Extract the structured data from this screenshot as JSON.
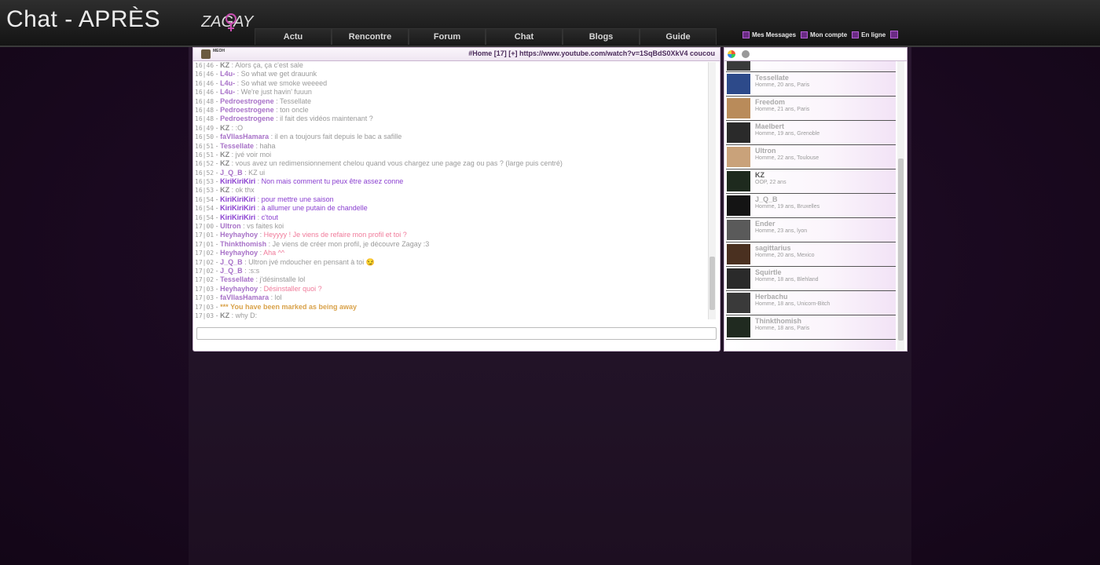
{
  "header": {
    "title": "Chat - APRÈS",
    "logo_text": "ZAGAY"
  },
  "nav": [
    {
      "label": "Actu"
    },
    {
      "label": "Rencontre"
    },
    {
      "label": "Forum"
    },
    {
      "label": "Chat"
    },
    {
      "label": "Blogs"
    },
    {
      "label": "Guide"
    }
  ],
  "user_links": {
    "messages": "Mes Messages",
    "account": "Mon compte",
    "online": "En ligne"
  },
  "chat": {
    "mini_tag": "MEOH",
    "topic": "#Home [17] [+] https://www.youtube.com/watch?v=1SqBdS0XkV4 coucou",
    "messages": [
      {
        "time": "16|46",
        "name": "KZ",
        "text": "Alors ça, ça c'est sale"
      },
      {
        "time": "16|46",
        "name": "L4u-",
        "text": "So what we get drauunk"
      },
      {
        "time": "16|46",
        "name": "L4u-",
        "text": "So what we smoke weeeed"
      },
      {
        "time": "16|46",
        "name": "L4u-",
        "text": "We're just havin' fuuun"
      },
      {
        "time": "16|48",
        "name": "Pedroestrogene",
        "text": "Tessellate"
      },
      {
        "time": "16|48",
        "name": "Pedroestrogene",
        "text": "ton oncle"
      },
      {
        "time": "16|48",
        "name": "Pedroestrogene",
        "text": "il fait des vidéos maintenant ?"
      },
      {
        "time": "16|49",
        "name": "KZ",
        "text": ":O"
      },
      {
        "time": "16|50",
        "name": "faVIlasHamara",
        "text": "il en a toujours fait depuis le bac a safille"
      },
      {
        "time": "16|51",
        "name": "Tessellate",
        "text": "haha"
      },
      {
        "time": "16|51",
        "name": "KZ",
        "text": "jvé voir moi"
      },
      {
        "time": "16|52",
        "name": "KZ",
        "text": "vous avez un redimensionnement chelou quand vous chargez une page zag ou pas ? (large puis centré)"
      },
      {
        "time": "16|52",
        "name": "J_Q_B",
        "text": "KZ ui"
      },
      {
        "time": "16|53",
        "name": "KiriKiriKiri",
        "text": "Non mais comment tu peux être assez conne"
      },
      {
        "time": "16|53",
        "name": "KZ",
        "text": "ok thx"
      },
      {
        "time": "16|54",
        "name": "KiriKiriKiri",
        "text": "pour mettre une saison"
      },
      {
        "time": "16|54",
        "name": "KiriKiriKiri",
        "text": "à allumer une putain de chandelle"
      },
      {
        "time": "16|54",
        "name": "KiriKiriKiri",
        "text": "c'tout"
      },
      {
        "time": "17|00",
        "name": "Ultron",
        "text": "vs faites koi"
      },
      {
        "time": "17|01",
        "name": "Heyhayhoy",
        "text": "Heyyyy ! Je viens de refaire mon profil et toi ?"
      },
      {
        "time": "17|01",
        "name": "Thinkthomish",
        "text": "Je viens de créer mon profil, je découvre Zagay :3"
      },
      {
        "time": "17|02",
        "name": "Heyhayhoy",
        "text": "Aha ^^"
      },
      {
        "time": "17|02",
        "name": "J_Q_B",
        "text": "Ultron jvé mdoucher en pensant à toi 😏"
      },
      {
        "time": "17|02",
        "name": "J_Q_B",
        "text": ":s:s"
      },
      {
        "time": "17|02",
        "name": "Tessellate",
        "text": "j'désinstalle lol"
      },
      {
        "time": "17|03",
        "name": "Heyhayhoy",
        "text": "Désinstaller quoi ?"
      },
      {
        "time": "17|03",
        "name": "faVIlasHamara",
        "text": "lol"
      },
      {
        "time": "17|03",
        "name": "***",
        "text": "You have been marked as being away"
      },
      {
        "time": "17|03",
        "name": "KZ",
        "text": "why D:"
      }
    ]
  },
  "users": [
    {
      "name": "Tessellate",
      "info": "Homme, 20 ans, Paris",
      "avatar_color": "#2d4a8a"
    },
    {
      "name": "Freedom",
      "info": "Homme, 21 ans, Paris",
      "avatar_color": "#b98b5a"
    },
    {
      "name": "Maelbert",
      "info": "Homme, 19 ans, Grenoble",
      "avatar_color": "#2a2a2a"
    },
    {
      "name": "Ultron",
      "info": "Homme, 22 ans, Toulouse",
      "avatar_color": "#c9a27a"
    },
    {
      "name": "KZ",
      "info": "OOP, 22 ans",
      "avatar_color": "#1e2a1e"
    },
    {
      "name": "J_Q_B",
      "info": "Homme, 19 ans, Bruxelles",
      "avatar_color": "#141414"
    },
    {
      "name": "Ender",
      "info": "Homme, 23 ans, lyon",
      "avatar_color": "#5a5a5a"
    },
    {
      "name": "sagittarius",
      "info": "Homme, 20 ans, Mexico",
      "avatar_color": "#4a3020"
    },
    {
      "name": "Squirtle",
      "info": "Homme, 18 ans, Blehland",
      "avatar_color": "#2a2a2a"
    },
    {
      "name": "Herbachu",
      "info": "Homme, 18 ans, Unicorn-Bitch",
      "avatar_color": "#3a3a3a"
    },
    {
      "name": "Thinkthomish",
      "info": "Homme, 18 ans, Paris",
      "avatar_color": "#202a20"
    }
  ],
  "colors": {
    "accent": "#a872c8",
    "purple_bg": "#1c0a22",
    "away_color": "#d9a24a",
    "pink_text": "#f07a9a",
    "link_purple": "#8a3fd0"
  }
}
